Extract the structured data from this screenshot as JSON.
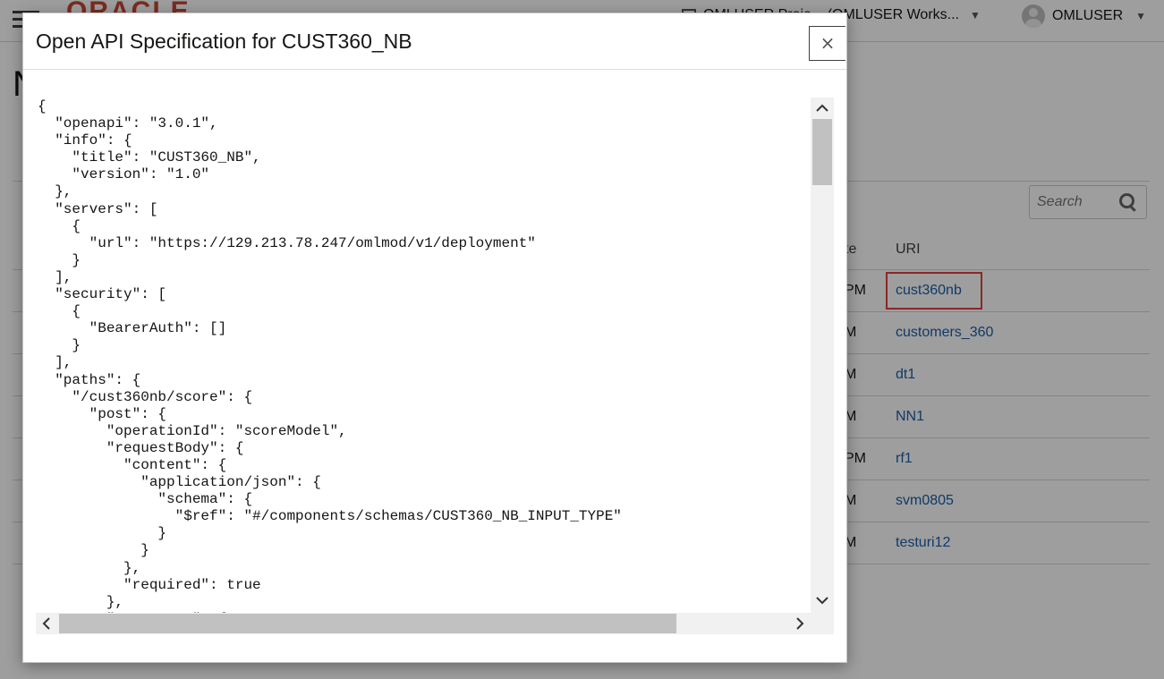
{
  "topbar": {
    "logo_text": "ORACLE",
    "workspace_label": "OMLUSER Project (OMLUSER Workspace)",
    "workspace_display": "OMLUSER Proje... (OMLUSER Works...",
    "user_name": "OMLUSER"
  },
  "page": {
    "heading_fragment": "N",
    "search_placeholder": "Search",
    "columns": {
      "time_fragment": "te",
      "uri": "URI"
    },
    "rows": [
      {
        "time_fragment": "PM",
        "uri": "cust360nb",
        "highlighted": true
      },
      {
        "time_fragment": "M",
        "uri": "customers_360"
      },
      {
        "time_fragment": "M",
        "uri": "dt1"
      },
      {
        "time_fragment": "M",
        "uri": "NN1"
      },
      {
        "time_fragment": "PM",
        "uri": "rf1"
      },
      {
        "time_fragment": "M",
        "uri": "svm0805"
      },
      {
        "time_fragment": "M",
        "uri": "testuri12"
      }
    ],
    "highlight_color": "#e04040",
    "link_color": "#1a5ea6"
  },
  "dialog": {
    "title": "Open API Specification for CUST360_NB",
    "close_label": "×",
    "close_icon": "close-icon",
    "spec_lines": [
      "{",
      "  \"openapi\": \"3.0.1\",",
      "  \"info\": {",
      "    \"title\": \"CUST360_NB\",",
      "    \"version\": \"1.0\"",
      "  },",
      "  \"servers\": [",
      "    {",
      "      \"url\": \"https://129.213.78.247/omlmod/v1/deployment\"",
      "    }",
      "  ],",
      "  \"security\": [",
      "    {",
      "      \"BearerAuth\": []",
      "    }",
      "  ],",
      "  \"paths\": {",
      "    \"/cust360nb/score\": {",
      "      \"post\": {",
      "        \"operationId\": \"scoreModel\",",
      "        \"requestBody\": {",
      "          \"content\": {",
      "            \"application/json\": {",
      "              \"schema\": {",
      "                \"$ref\": \"#/components/schemas/CUST360_NB_INPUT_TYPE\"",
      "              }",
      "            }",
      "          },",
      "          \"required\": true",
      "        },",
      "        \"responses\": {"
    ]
  }
}
